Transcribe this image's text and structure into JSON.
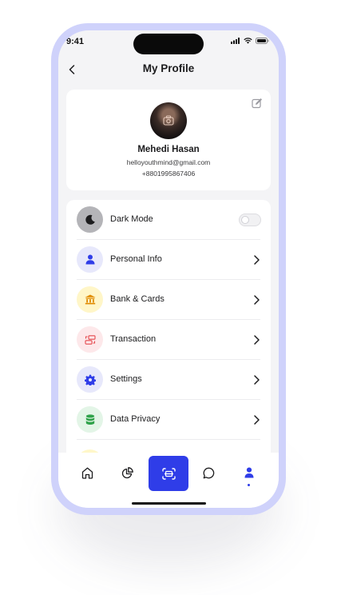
{
  "status_bar": {
    "time": "9:41"
  },
  "header": {
    "title": "My Profile"
  },
  "profile": {
    "name": "Mehedi Hasan",
    "email": "helloyouthmind@gmail.com",
    "phone": "+8801995867406"
  },
  "menu": {
    "items": [
      {
        "label": "Dark Mode",
        "icon": "moon-icon",
        "icon_bg": "#b4b4b8",
        "icon_color": "#1c1c1e",
        "control": "toggle",
        "toggle_on": false
      },
      {
        "label": "Personal Info",
        "icon": "user-icon",
        "icon_bg": "#e7e8fb",
        "icon_color": "#2f3de8",
        "control": "chevron"
      },
      {
        "label": "Bank & Cards",
        "icon": "bank-icon",
        "icon_bg": "#fff6c8",
        "icon_color": "#e08a00",
        "control": "chevron"
      },
      {
        "label": "Transaction",
        "icon": "transaction-icon",
        "icon_bg": "#fde8ea",
        "icon_color": "#e5484d",
        "control": "chevron"
      },
      {
        "label": "Settings",
        "icon": "gear-icon",
        "icon_bg": "#e7e8fb",
        "icon_color": "#2f3de8",
        "control": "chevron"
      },
      {
        "label": "Data Privacy",
        "icon": "database-icon",
        "icon_bg": "#e3f5e7",
        "icon_color": "#2fa24a",
        "control": "chevron"
      }
    ]
  },
  "tab_bar": {
    "tabs": [
      "home-icon",
      "pie-chart-icon",
      "scan-icon",
      "chat-icon",
      "profile-icon"
    ],
    "active": "profile-icon"
  },
  "colors": {
    "accent": "#2f3de8",
    "frame": "#cfd2fb",
    "background": "#f4f4f6"
  }
}
